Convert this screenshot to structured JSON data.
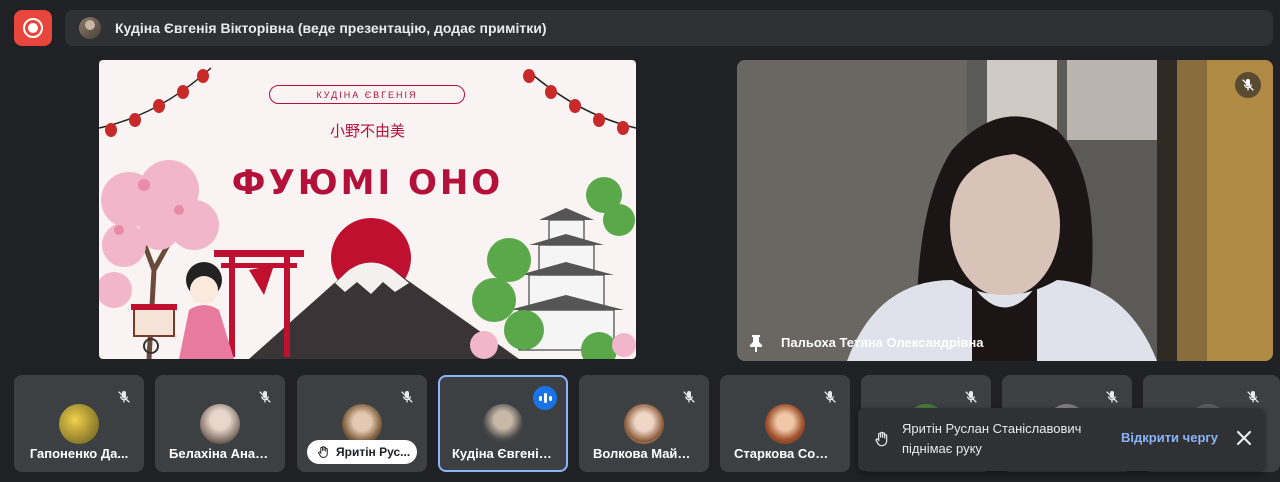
{
  "presenter_bar": {
    "text": "Кудіна Євгенія Вікторівна (веде презентацію, додає примітки)"
  },
  "slide": {
    "name_pill": "КУДІНА ЄВГЕНІЯ",
    "kanji": "小野不由美",
    "title": "ФУЮМІ   ОНО"
  },
  "main_camera": {
    "name": "Пальоха Тетяна Олександрівна"
  },
  "participants": [
    {
      "name": "Гапоненко Да..."
    },
    {
      "name": "Белахіна Анас..."
    },
    {
      "name": "",
      "hand_label": "Яритін Рус..."
    },
    {
      "name": "Кудіна Євгенія..."
    },
    {
      "name": "Волкова Майя ..."
    },
    {
      "name": "Старкова Софі..."
    },
    {
      "name": ""
    },
    {
      "name": ""
    },
    {
      "name": ""
    }
  ],
  "toast": {
    "line1": "Яритін Руслан Станіславович",
    "line2": "піднімає руку",
    "action": "Відкрити чергу"
  },
  "colors": {
    "record": "#e8453c",
    "accent_blue": "#8ab4f8",
    "slide_red": "#b3103a"
  },
  "icons": [
    "record-icon",
    "mic-off-icon",
    "pin-icon",
    "raised-hand-icon",
    "close-icon",
    "speaking-indicator-icon"
  ]
}
